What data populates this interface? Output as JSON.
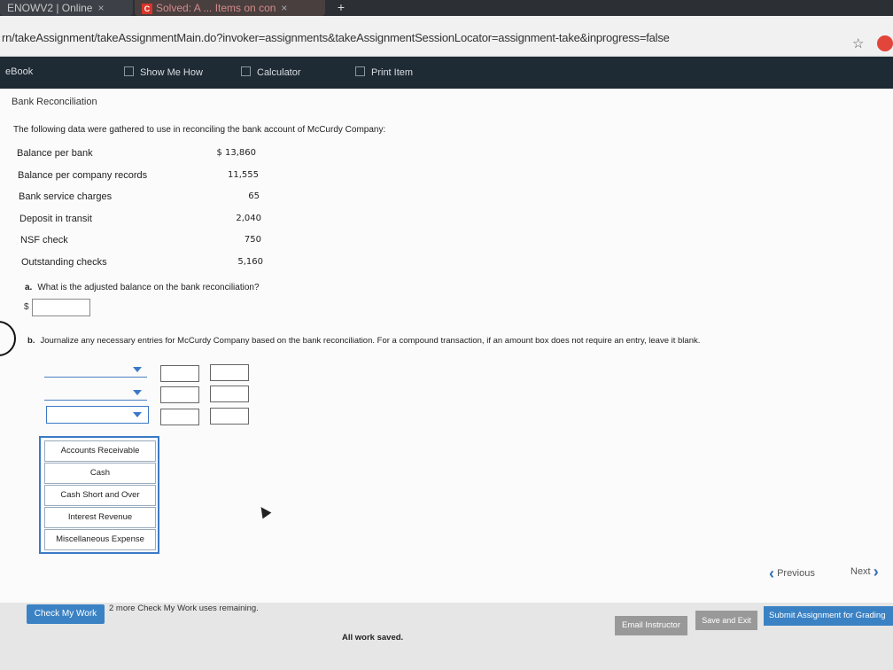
{
  "browser": {
    "tabs": [
      {
        "label": "ENOWV2 | Online"
      },
      {
        "label": "Solved: A ... Items on con"
      }
    ],
    "url": "rn/takeAssignment/takeAssignmentMain.do?invoker=assignments&takeAssignmentSessionLocator=assignment-take&inprogress=false"
  },
  "toolbar": {
    "ebook": "eBook",
    "show_me_how": "Show Me How",
    "calculator": "Calculator",
    "print_item": "Print Item"
  },
  "problem": {
    "title": "Bank Reconciliation",
    "intro": "The following data were gathered to use in reconciling the bank account of McCurdy Company:",
    "rows": [
      {
        "label": "Balance per bank",
        "value": "$ 13,860"
      },
      {
        "label": "Balance per company records",
        "value": "11,555"
      },
      {
        "label": "Bank service charges",
        "value": "65"
      },
      {
        "label": "Deposit in transit",
        "value": "2,040"
      },
      {
        "label": "NSF check",
        "value": "750"
      },
      {
        "label": "Outstanding checks",
        "value": "5,160"
      }
    ],
    "part_a": {
      "letter": "a.",
      "question": "What is the adjusted balance on the bank reconciliation?",
      "currency": "$"
    },
    "part_b": {
      "letter": "b.",
      "question": "Journalize any necessary entries for McCurdy Company based on the bank reconciliation. For a compound transaction, if an amount box does not require an entry, leave it blank."
    },
    "account_options": [
      "Accounts Receivable",
      "Cash",
      "Cash Short and Over",
      "Interest Revenue",
      "Miscellaneous Expense"
    ]
  },
  "nav": {
    "previous": "Previous",
    "next": "Next"
  },
  "footer": {
    "check_my_work": "Check My Work",
    "remaining": "2 more Check My Work uses remaining.",
    "email_instructor": "Email Instructor",
    "save_and_exit": "Save and Exit",
    "submit": "Submit Assignment for Grading",
    "status": "All work saved."
  }
}
